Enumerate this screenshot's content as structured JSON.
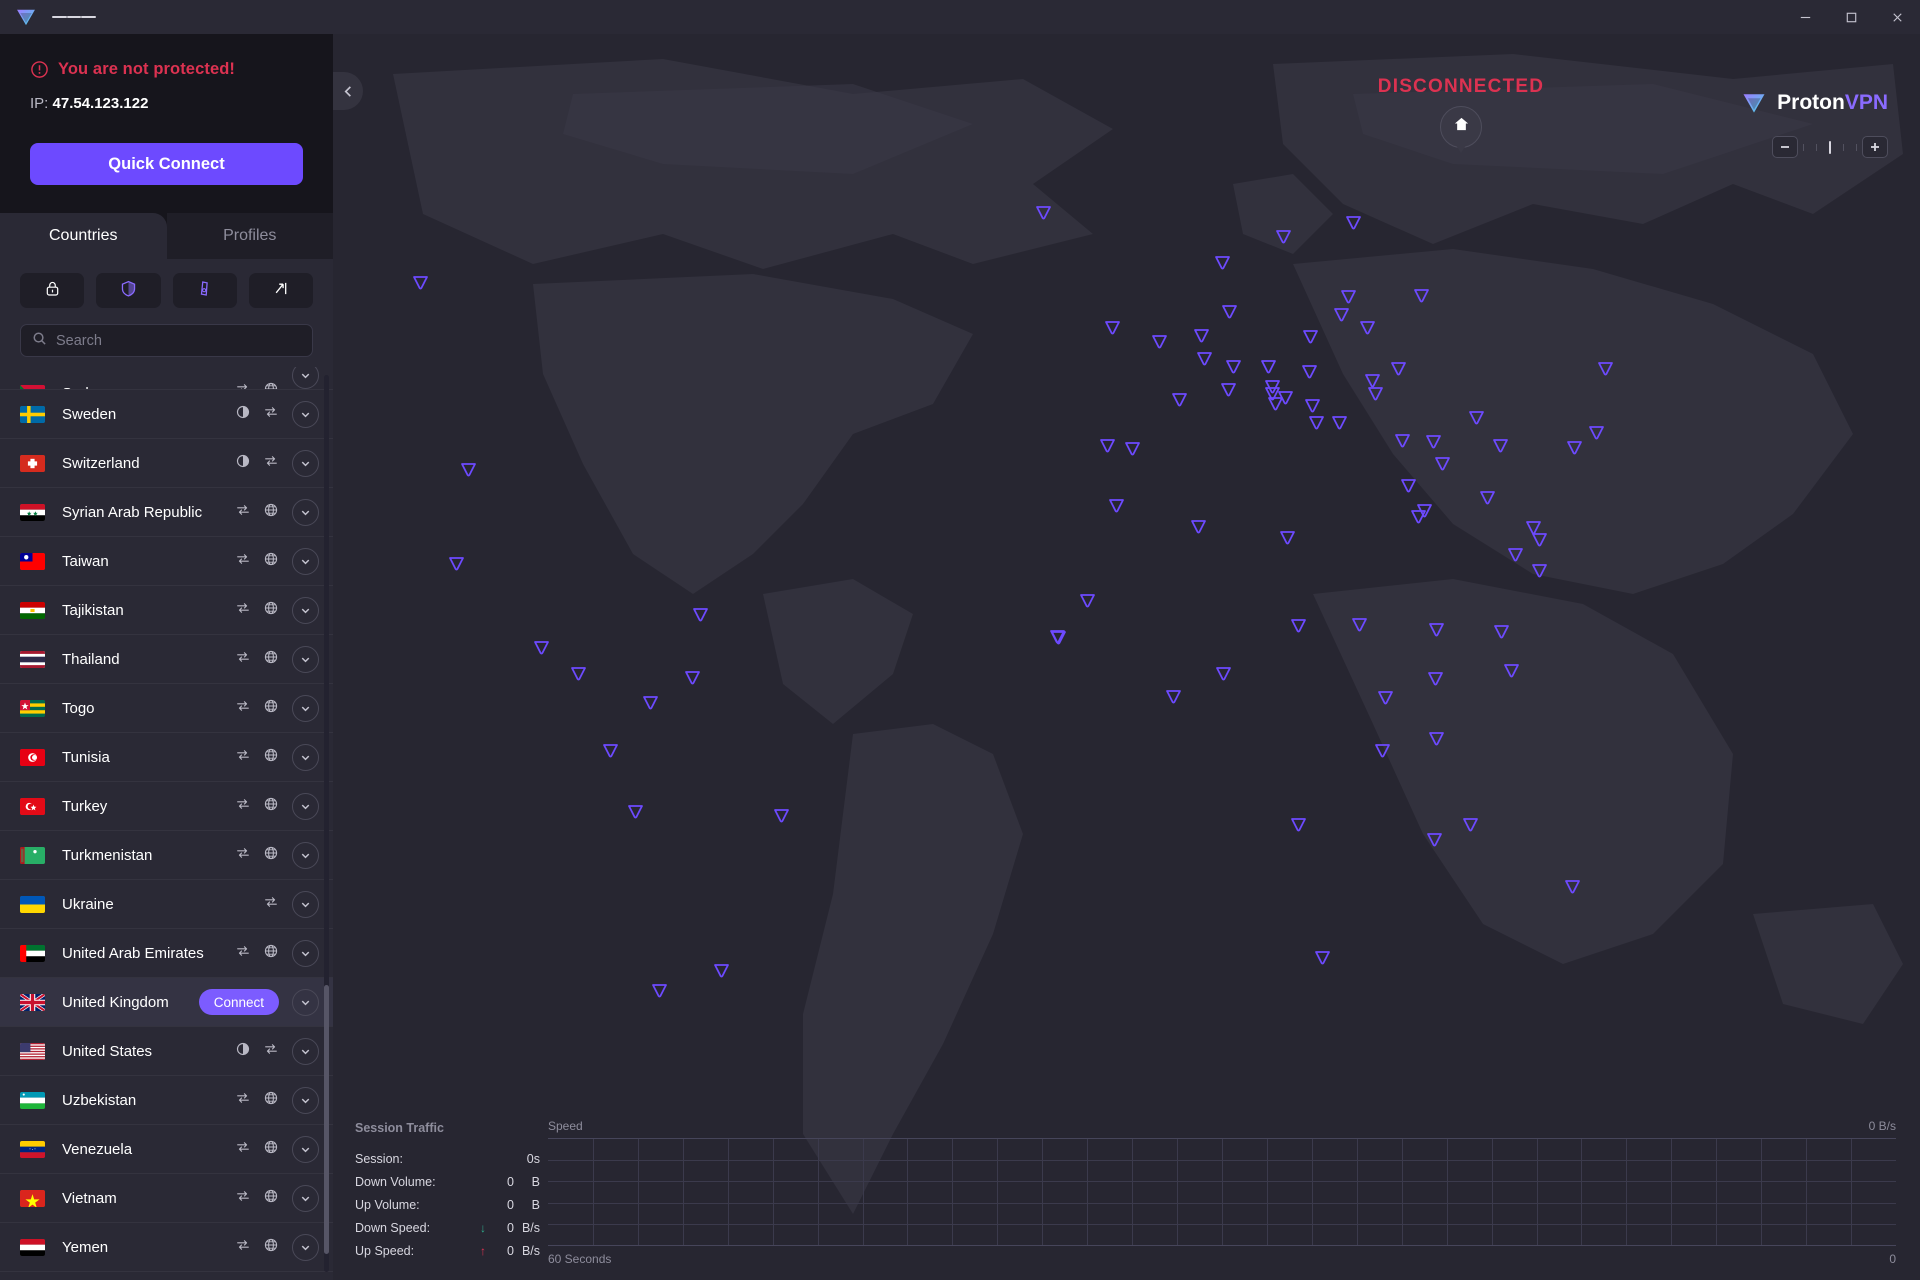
{
  "window": {
    "minimize_label": "minimize",
    "maximize_label": "maximize",
    "close_label": "close"
  },
  "sidebar": {
    "status_text": "You are not protected!",
    "ip_label": "IP:",
    "ip_value": "47.54.123.122",
    "quick_connect_label": "Quick Connect",
    "tabs": [
      {
        "label": "Countries",
        "active": true
      },
      {
        "label": "Profiles",
        "active": false
      }
    ],
    "filters": [
      {
        "name": "secure-core-filter",
        "icon": "lock-icon"
      },
      {
        "name": "p2p-filter",
        "icon": "shield-icon"
      },
      {
        "name": "tor-filter",
        "icon": "onion-icon"
      },
      {
        "name": "streaming-filter",
        "icon": "arrow-bar-icon"
      }
    ],
    "search": {
      "placeholder": "Search",
      "value": ""
    },
    "countries": [
      {
        "name": "Sudan",
        "flag": "SD",
        "icons": [
          "p2p",
          "tor"
        ],
        "partial": true,
        "hovered": false
      },
      {
        "name": "Sweden",
        "flag": "SE",
        "icons": [
          "securecore",
          "p2p"
        ],
        "partial": false,
        "hovered": false
      },
      {
        "name": "Switzerland",
        "flag": "CH",
        "icons": [
          "securecore",
          "p2p"
        ],
        "partial": false,
        "hovered": false
      },
      {
        "name": "Syrian Arab Republic",
        "flag": "SY",
        "icons": [
          "p2p",
          "tor"
        ],
        "partial": false,
        "hovered": false
      },
      {
        "name": "Taiwan",
        "flag": "TW",
        "icons": [
          "p2p",
          "tor"
        ],
        "partial": false,
        "hovered": false
      },
      {
        "name": "Tajikistan",
        "flag": "TJ",
        "icons": [
          "p2p",
          "tor"
        ],
        "partial": false,
        "hovered": false
      },
      {
        "name": "Thailand",
        "flag": "TH",
        "icons": [
          "p2p",
          "tor"
        ],
        "partial": false,
        "hovered": false
      },
      {
        "name": "Togo",
        "flag": "TG",
        "icons": [
          "p2p",
          "tor"
        ],
        "partial": false,
        "hovered": false
      },
      {
        "name": "Tunisia",
        "flag": "TN",
        "icons": [
          "p2p",
          "tor"
        ],
        "partial": false,
        "hovered": false
      },
      {
        "name": "Turkey",
        "flag": "TR",
        "icons": [
          "p2p",
          "tor"
        ],
        "partial": false,
        "hovered": false
      },
      {
        "name": "Turkmenistan",
        "flag": "TM",
        "icons": [
          "p2p",
          "tor"
        ],
        "partial": false,
        "hovered": false
      },
      {
        "name": "Ukraine",
        "flag": "UA",
        "icons": [
          "p2p"
        ],
        "partial": false,
        "hovered": false
      },
      {
        "name": "United Arab Emirates",
        "flag": "AE",
        "icons": [
          "p2p",
          "tor"
        ],
        "partial": false,
        "hovered": false
      },
      {
        "name": "United Kingdom",
        "flag": "GB",
        "icons": [],
        "partial": false,
        "hovered": true,
        "connect_label": "Connect"
      },
      {
        "name": "United States",
        "flag": "US",
        "icons": [
          "securecore",
          "p2p"
        ],
        "partial": false,
        "hovered": false
      },
      {
        "name": "Uzbekistan",
        "flag": "UZ",
        "icons": [
          "p2p",
          "tor"
        ],
        "partial": false,
        "hovered": false
      },
      {
        "name": "Venezuela",
        "flag": "VE",
        "icons": [
          "p2p",
          "tor"
        ],
        "partial": false,
        "hovered": false
      },
      {
        "name": "Vietnam",
        "flag": "VN",
        "icons": [
          "p2p",
          "tor"
        ],
        "partial": false,
        "hovered": false
      },
      {
        "name": "Yemen",
        "flag": "YE",
        "icons": [
          "p2p",
          "tor"
        ],
        "partial": false,
        "hovered": false
      }
    ]
  },
  "map": {
    "connection_status": "DISCONNECTED",
    "brand_first": "Proton",
    "brand_second": "VPN",
    "zoom_out_label": "−",
    "zoom_in_label": "+"
  },
  "traffic": {
    "title": "Session Traffic",
    "rows": [
      {
        "label": "Session:",
        "arrow": "",
        "value": "",
        "unit": "0s"
      },
      {
        "label": "Down Volume:",
        "arrow": "",
        "value": "0",
        "unit": "B"
      },
      {
        "label": "Up Volume:",
        "arrow": "",
        "value": "0",
        "unit": "B"
      },
      {
        "label": "Down Speed:",
        "arrow": "↓",
        "value": "0",
        "unit": "B/s"
      },
      {
        "label": "Up Speed:",
        "arrow": "↑",
        "value": "0",
        "unit": "B/s"
      }
    ]
  },
  "chart_data": {
    "type": "line",
    "title": "Speed",
    "ylabel": "Speed",
    "xlabel": "60 Seconds",
    "y_max_label": "0 B/s",
    "x_left_label": "60 Seconds",
    "x_right_label": "0",
    "grid": true,
    "series": [
      {
        "name": "Down Speed",
        "values": [
          0,
          0,
          0,
          0,
          0,
          0,
          0,
          0,
          0,
          0,
          0,
          0,
          0,
          0,
          0,
          0,
          0,
          0,
          0,
          0
        ]
      },
      {
        "name": "Up Speed",
        "values": [
          0,
          0,
          0,
          0,
          0,
          0,
          0,
          0,
          0,
          0,
          0,
          0,
          0,
          0,
          0,
          0,
          0,
          0,
          0,
          0
        ]
      }
    ],
    "ylim": [
      0,
      0
    ],
    "xlim": [
      60,
      0
    ]
  },
  "colors": {
    "accent": "#6d4aff",
    "danger": "#dc3251",
    "pin": "#6d4aff",
    "sidebar_bg": "#16151c",
    "panel_bg": "#2a2935",
    "map_bg": "#272631"
  }
}
